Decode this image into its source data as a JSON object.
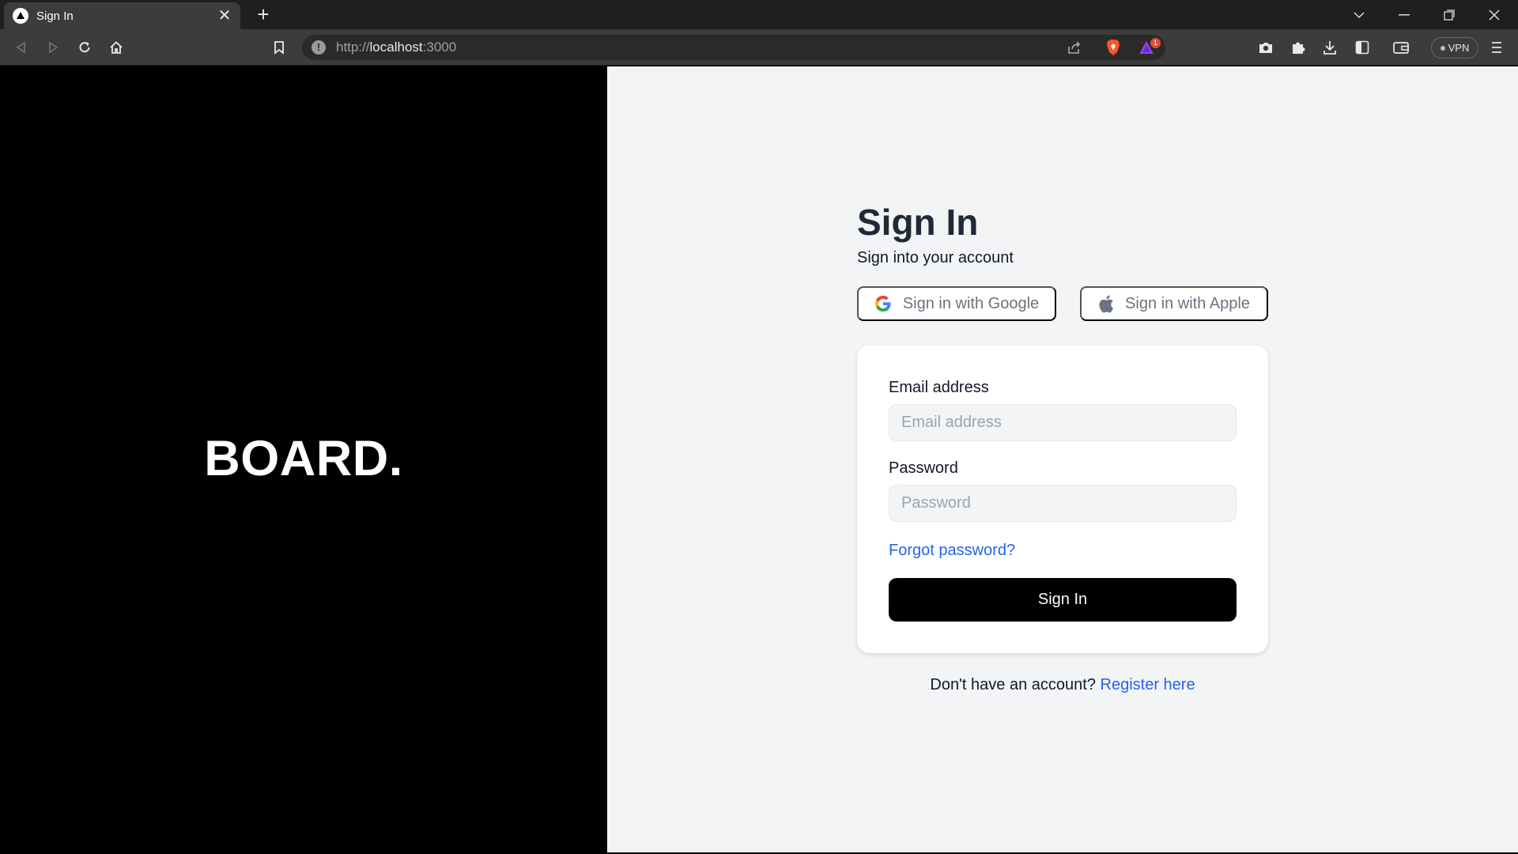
{
  "browser": {
    "tab_title": "Sign In",
    "tab_close": "✕",
    "new_tab": "+",
    "url_prefix": "http://",
    "url_host": "localhost",
    "url_suffix": ":3000",
    "url_info_icon": "!",
    "vpn_label": "VPN",
    "notification_badge": "1"
  },
  "brand": {
    "logo_text": "BOARD."
  },
  "signin": {
    "title": "Sign In",
    "subtitle": "Sign into your account",
    "google_button": "Sign in with Google",
    "apple_button": "Sign in with Apple",
    "email_label": "Email address",
    "email_placeholder": "Email address",
    "email_value": "",
    "password_label": "Password",
    "password_placeholder": "Password",
    "password_value": "",
    "forgot_link": "Forgot password?",
    "submit_button": "Sign In",
    "register_prompt": "Don't have an account?",
    "register_link": "Register here"
  },
  "colors": {
    "accent_link": "#2563eb",
    "primary_button": "#000000",
    "page_background": "#f3f4f6",
    "left_panel": "#000000"
  }
}
